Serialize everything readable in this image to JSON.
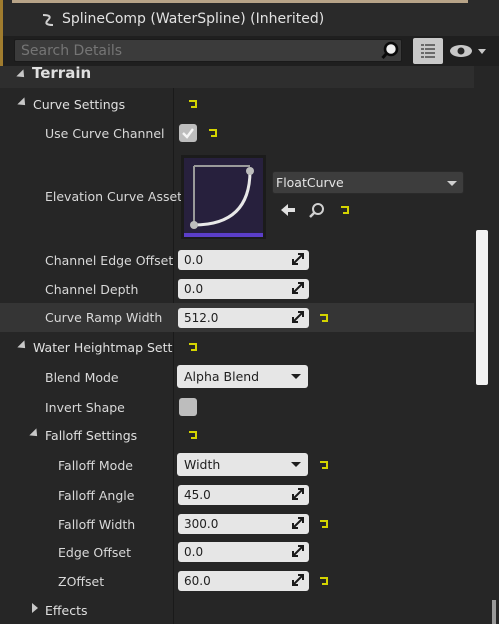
{
  "component_label": "SplineComp (WaterSpline) (Inherited)",
  "search": {
    "placeholder": "Search Details"
  },
  "section_title": "Terrain",
  "categories": {
    "curve_settings": "Curve Settings",
    "water_heightmap": "Water Heightmap Setting",
    "falloff_settings": "Falloff Settings",
    "effects": "Effects"
  },
  "properties": {
    "use_curve_channel": {
      "label": "Use Curve Channel",
      "checked": true
    },
    "elevation_curve_asset": {
      "label": "Elevation Curve Asset",
      "value": "FloatCurve"
    },
    "channel_edge_offset": {
      "label": "Channel Edge Offset",
      "value": "0.0"
    },
    "channel_depth": {
      "label": "Channel Depth",
      "value": "0.0"
    },
    "curve_ramp_width": {
      "label": "Curve Ramp Width",
      "value": "512.0"
    },
    "blend_mode": {
      "label": "Blend Mode",
      "value": "Alpha Blend"
    },
    "invert_shape": {
      "label": "Invert Shape",
      "checked": false
    },
    "falloff_mode": {
      "label": "Falloff Mode",
      "value": "Width"
    },
    "falloff_angle": {
      "label": "Falloff Angle",
      "value": "45.0"
    },
    "falloff_width": {
      "label": "Falloff Width",
      "value": "300.0"
    },
    "edge_offset": {
      "label": "Edge Offset",
      "value": "0.0"
    },
    "zoffset": {
      "label": "ZOffset",
      "value": "60.0"
    }
  },
  "colors": {
    "accent_yellow": "#d4d400",
    "curve_thumb_bg": "#27203d",
    "curve_thumb_bar": "#5b3ec8"
  }
}
